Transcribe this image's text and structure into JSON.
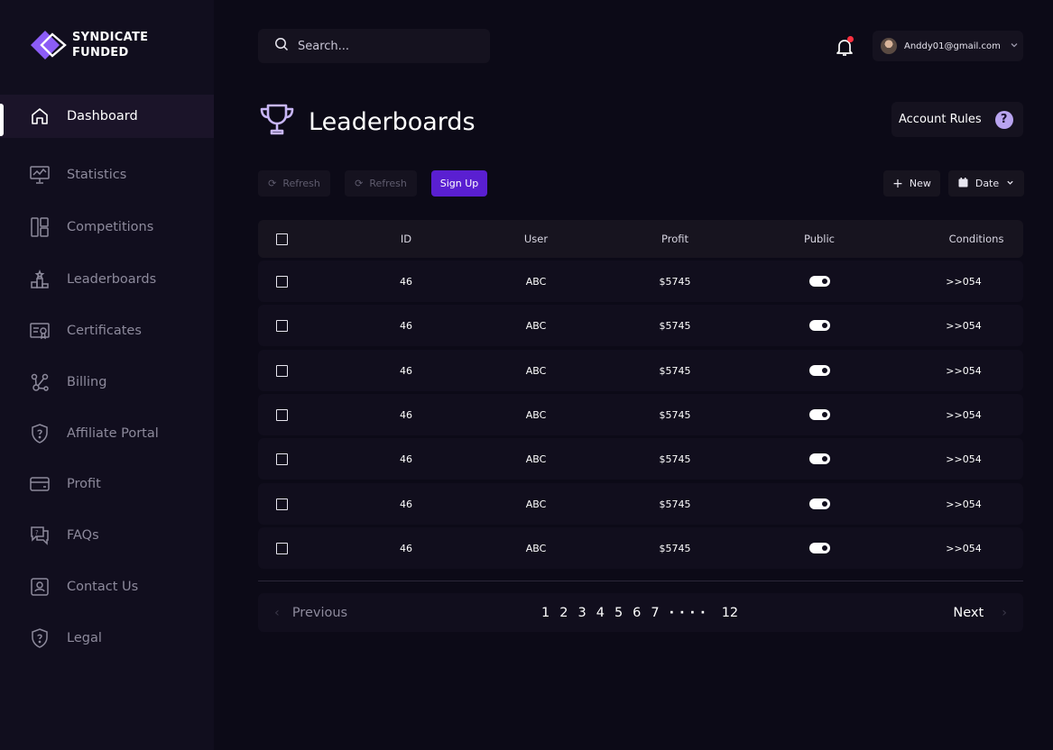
{
  "brand": {
    "line1": "SYNDICATE",
    "line2": "FUNDED"
  },
  "sidebar": {
    "items": [
      {
        "label": "Dashboard",
        "icon": "home-icon",
        "active": true
      },
      {
        "label": "Statistics",
        "icon": "chart-board-icon"
      },
      {
        "label": "Competitions",
        "icon": "layout-icon"
      },
      {
        "label": "Leaderboards",
        "icon": "podium-icon"
      },
      {
        "label": "Certificates",
        "icon": "certificate-icon"
      },
      {
        "label": "Billing",
        "icon": "nodes-icon"
      },
      {
        "label": "Affiliate Portal",
        "icon": "shield-icon"
      },
      {
        "label": "Profit",
        "icon": "wallet-icon"
      },
      {
        "label": "FAQs",
        "icon": "chat-icon"
      },
      {
        "label": "Contact Us",
        "icon": "contact-icon"
      },
      {
        "label": "Legal",
        "icon": "shield-icon"
      }
    ]
  },
  "search": {
    "placeholder": "Search..."
  },
  "account": {
    "email": "Anddy01@gmail.com"
  },
  "page": {
    "title": "Leaderboards",
    "rules_label": "Account Rules",
    "help_glyph": "?"
  },
  "toolbar": {
    "refresh1": "Refresh",
    "refresh2": "Refresh",
    "signup": "Sign Up",
    "new": "New",
    "date": "Date"
  },
  "table": {
    "headers": [
      "ID",
      "User",
      "Profit",
      "Public",
      "Conditions"
    ],
    "rows": [
      {
        "id": "46",
        "user": "ABC",
        "profit": "$5745",
        "public": true,
        "conditions": ">>054"
      },
      {
        "id": "46",
        "user": "ABC",
        "profit": "$5745",
        "public": true,
        "conditions": ">>054"
      },
      {
        "id": "46",
        "user": "ABC",
        "profit": "$5745",
        "public": true,
        "conditions": ">>054"
      },
      {
        "id": "46",
        "user": "ABC",
        "profit": "$5745",
        "public": true,
        "conditions": ">>054"
      },
      {
        "id": "46",
        "user": "ABC",
        "profit": "$5745",
        "public": true,
        "conditions": ">>054"
      },
      {
        "id": "46",
        "user": "ABC",
        "profit": "$5745",
        "public": true,
        "conditions": ">>054"
      },
      {
        "id": "46",
        "user": "ABC",
        "profit": "$5745",
        "public": true,
        "conditions": ">>054"
      }
    ]
  },
  "pagination": {
    "previous": "Previous",
    "next": "Next",
    "pages": [
      "1",
      "2",
      "3",
      "4",
      "5",
      "6",
      "7"
    ],
    "ellipsis": "····",
    "last": "12"
  },
  "colors": {
    "accent": "#5a1fd1",
    "logo": "#8b5cf6",
    "background": "#0c0a17",
    "sidebar": "#110e1e"
  }
}
